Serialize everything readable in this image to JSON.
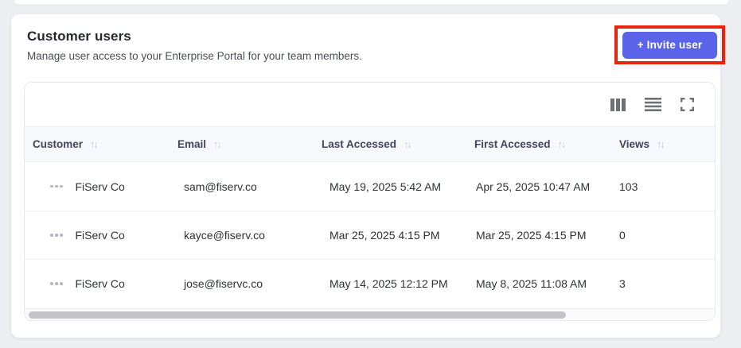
{
  "page": {
    "title": "Customer users",
    "subtitle": "Manage user access to your Enterprise Portal for your team members.",
    "invite_button_label": "+ Invite user"
  },
  "toolbar": {
    "icons": [
      "columns-icon",
      "row-density-icon",
      "fullscreen-icon"
    ]
  },
  "table": {
    "columns": [
      "Customer",
      "Email",
      "Last Accessed",
      "First Accessed",
      "Views"
    ],
    "sort_icon": "↑↓",
    "rows": [
      {
        "customer": "FiServ Co",
        "email": "sam@fiserv.co",
        "last_accessed": "May 19, 2025 5:42 AM",
        "first_accessed": "Apr 25, 2025 10:47 AM",
        "views": "103"
      },
      {
        "customer": "FiServ Co",
        "email": "kayce@fiserv.co",
        "last_accessed": "Mar 25, 2025 4:15 PM",
        "first_accessed": "Mar 25, 2025 4:15 PM",
        "views": "0"
      },
      {
        "customer": "FiServ Co",
        "email": "jose@fiservc.co",
        "last_accessed": "May 14, 2025 12:12 PM",
        "first_accessed": "May 8, 2025 11:08 AM",
        "views": "3"
      }
    ]
  },
  "colors": {
    "accent": "#5b63e8",
    "annotation_highlight": "#e8250c",
    "header_row_bg": "#f7f8fb"
  }
}
